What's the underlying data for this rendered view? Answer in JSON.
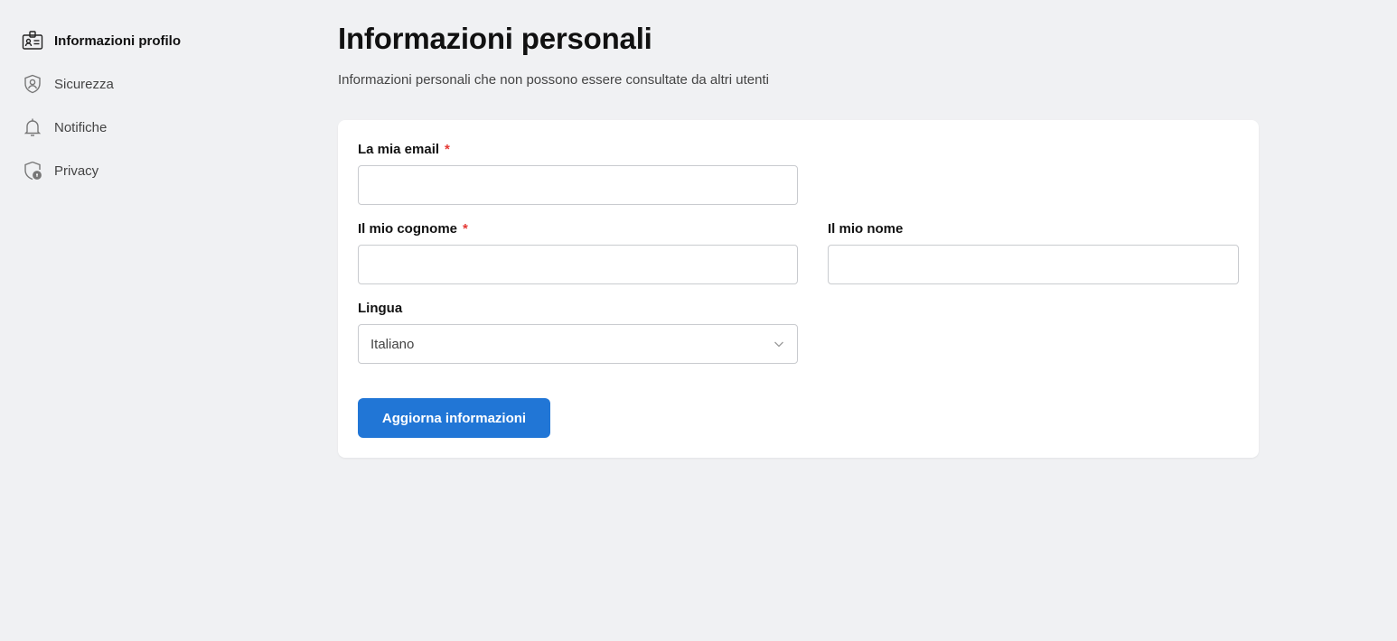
{
  "sidebar": {
    "items": [
      {
        "label": "Informazioni profilo",
        "icon": "id-card-icon",
        "active": true
      },
      {
        "label": "Sicurezza",
        "icon": "shield-user-icon",
        "active": false
      },
      {
        "label": "Notifiche",
        "icon": "bell-icon",
        "active": false
      },
      {
        "label": "Privacy",
        "icon": "shield-lock-icon",
        "active": false
      }
    ]
  },
  "header": {
    "title": "Informazioni personali",
    "subtitle": "Informazioni personali che non possono essere consultate da altri utenti"
  },
  "form": {
    "email": {
      "label": "La mia email",
      "required_mark": "*",
      "value": "",
      "placeholder": ""
    },
    "cognome": {
      "label": "Il mio cognome",
      "required_mark": "*",
      "value": "",
      "placeholder": ""
    },
    "nome": {
      "label": "Il mio nome",
      "value": "",
      "placeholder": ""
    },
    "lingua": {
      "label": "Lingua",
      "selected": "Italiano"
    },
    "submit_label": "Aggiorna informazioni"
  },
  "colors": {
    "background": "#f0f1f3",
    "accent": "#2176d6",
    "required": "#e53935",
    "card": "#ffffff"
  }
}
